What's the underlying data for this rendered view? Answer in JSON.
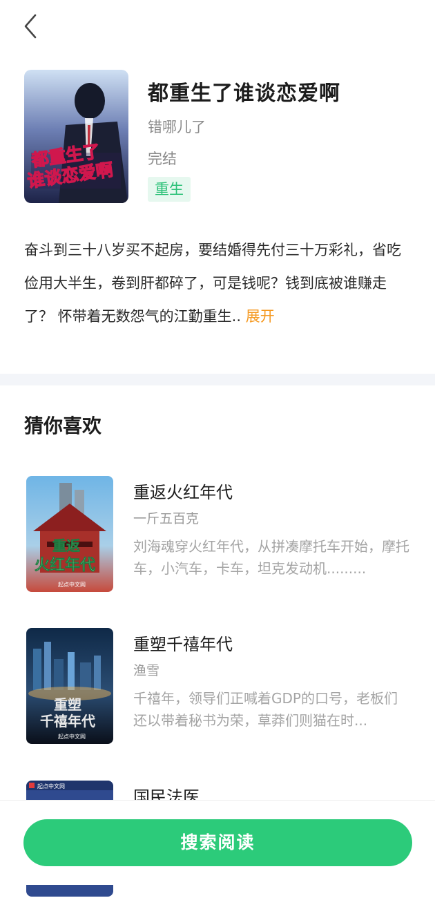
{
  "nav": {
    "back_icon": "chevron-left-icon"
  },
  "book": {
    "title": "都重生了谁谈恋爱啊",
    "author": "错哪儿了",
    "status": "完结",
    "tag": "重生",
    "cover_title_line1": "都重生了",
    "cover_title_line2": "谁谈恋爱啊",
    "description": "奋斗到三十八岁买不起房，要结婚得先付三十万彩礼，省吃俭用大半生，卷到肝都碎了，可是钱呢？钱到底被谁赚走了？ 怀带着无数怨气的江勤重生..",
    "expand_label": "展开"
  },
  "recommend": {
    "section_title": "猜你喜欢",
    "items": [
      {
        "title": "重返火红年代",
        "author": "一斤五百克",
        "description": "刘海魂穿火红年代，从拼凑摩托车开始，摩托车，小汽车，卡车，坦克发动机.........",
        "cover_text_1": "重返",
        "cover_text_2": "火红年代",
        "cover_brand": "起点中文网"
      },
      {
        "title": "重塑千禧年代",
        "author": "渔雪",
        "description": "千禧年，领导们正喊着GDP的口号，老板们还以带着秘书为荣，草莽们则猫在时...",
        "cover_text_1": "重塑",
        "cover_text_2": "千禧年代",
        "cover_brand": "起点中文网"
      },
      {
        "title": "国民法医",
        "author": "",
        "description": "",
        "cover_text_1": "",
        "cover_text_2": "",
        "cover_brand": "起点中文网"
      }
    ]
  },
  "footer": {
    "read_button_label": "搜索阅读"
  },
  "colors": {
    "accent": "#2ccb7a",
    "tag_text": "#2cc178",
    "expand": "#f59a23"
  }
}
